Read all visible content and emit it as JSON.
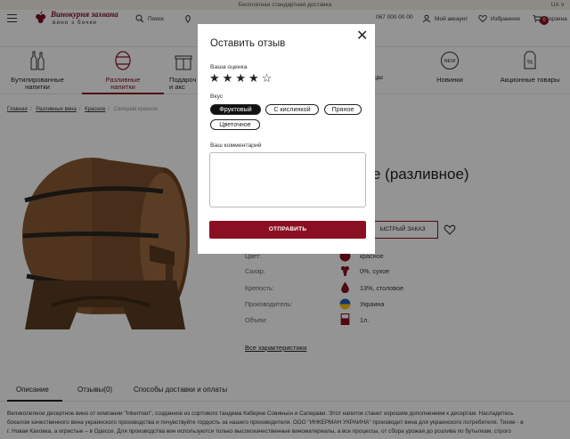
{
  "topbar": {
    "text": "Бесплатная стандартная доставка",
    "lang": "UA"
  },
  "header": {
    "logo_title": "Винокурня захвана",
    "logo_sub": "вино з бочки",
    "search": "Поиск",
    "phone": "067 000 00 00",
    "account": "Мой аккаунт",
    "wishlist": "Избранное",
    "cart": "Корзина",
    "cart_count": "0"
  },
  "categories": [
    {
      "label1": "Бутилированные",
      "label2": "напитки",
      "icon": "bottles-icon"
    },
    {
      "label1": "Разливные",
      "label2": "напитки",
      "icon": "barrel-icon",
      "active": true
    },
    {
      "label1": "Подароч",
      "label2": "и акс",
      "icon": "gift-icon"
    },
    {
      "label1": "",
      "label2": "цы",
      "icon": "glass-icon"
    },
    {
      "label1": "Новинки",
      "label2": "",
      "icon": "new-badge-icon"
    },
    {
      "label1": "Акционные товары",
      "label2": "",
      "icon": "sale-tag-icon"
    }
  ],
  "breadcrumbs": {
    "items": [
      "Главная",
      "Разливные вина",
      "Красное"
    ],
    "current": "Сапераві красное"
  },
  "product": {
    "title_visible": "е (разливное)",
    "quick_order": "ЫСТРЫЙ ЗАКАЗ",
    "specs": [
      {
        "key": "Цвет:",
        "value": "красное",
        "icon": "color-drop-icon"
      },
      {
        "key": "Сахар:",
        "value": "0%, сухое",
        "icon": "grapes-icon"
      },
      {
        "key": "Крепость:",
        "value": "13%, столовое",
        "icon": "strength-drop-icon"
      },
      {
        "key": "Производитель:",
        "value": "Украина",
        "icon": "ukraine-flag-icon"
      },
      {
        "key": "Объем:",
        "value": "1л.",
        "icon": "volume-icon"
      }
    ],
    "all_specs": "Все характеристики"
  },
  "tabs": [
    {
      "label": "Описание"
    },
    {
      "label": "Отзывы(0)"
    },
    {
      "label": "Способы доставки и оплаты"
    }
  ],
  "description": {
    "line1": "Великолепное десертное вино от компании \"Inkerman\", созданное из сортового тандема Каберне Совиньон и Саперави. Этот напиток станет хорошим дополнением к десертам. Насладитесь",
    "line2": "бокалом качественного вина украинского производства и почувствуйте гордость за нашего производителя. ООО \"ИНКЕРМАН УКРАИНА\" производит вина для украинского потребителя. Тихие - в",
    "line3": "г. Новая Каховка, а игристые – в Одессе. Для производства вин используются только высококачественные виноматериалы, а все процессы, от сбора урожая до розлива по бутылкам, строго"
  },
  "modal": {
    "title": "Оставить отзыв",
    "rating_label": "Ваша оценка",
    "rating": 4,
    "rating_max": 5,
    "taste_label": "Вкус",
    "chips": [
      {
        "label": "Фруктовый",
        "selected": true
      },
      {
        "label": "С кислинкой",
        "selected": false
      },
      {
        "label": "Пряное",
        "selected": false
      },
      {
        "label": "Цветочное",
        "selected": false
      }
    ],
    "comment_label": "Ваш комментарий",
    "comment_value": "",
    "submit": "ОТПРАВИТЬ"
  },
  "colors": {
    "accent": "#8b0f22",
    "overlay": "rgba(0,0,0,0.42)"
  }
}
